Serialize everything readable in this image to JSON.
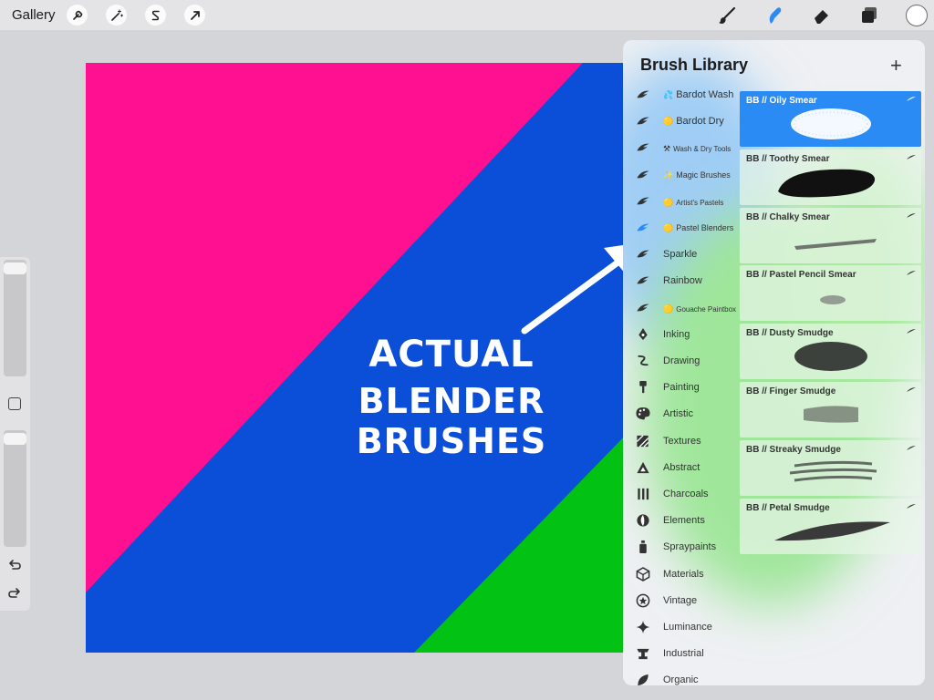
{
  "topbar": {
    "gallery_label": "Gallery",
    "left_tools": [
      "wrench-icon",
      "magic-wand-icon",
      "selection-s-icon",
      "transform-arrow-icon"
    ],
    "right_tools": [
      "paintbrush-icon",
      "smudge-icon",
      "eraser-icon",
      "layers-icon"
    ],
    "active_tool": "smudge-icon",
    "color_swatch": "#ffffff"
  },
  "canvas": {
    "colors": {
      "pink": "#ff1090",
      "blue": "#0b4ed8",
      "green": "#02c214"
    },
    "annotation": {
      "line1": "ACTUAL",
      "line2": "BLENDER BRUSHES"
    }
  },
  "panel": {
    "title": "Brush Library",
    "add_label": "+",
    "categories": [
      {
        "label": "Bardot Wash",
        "prefix": "💦"
      },
      {
        "label": "Bardot Dry",
        "prefix": "🟡"
      },
      {
        "label": "Wash & Dry Tools",
        "prefix": "⚒"
      },
      {
        "label": "Magic Brushes",
        "prefix": "✨"
      },
      {
        "label": "Artist's Pastels",
        "prefix": "🟡"
      },
      {
        "label": "Pastel Blenders",
        "prefix": "🟡"
      },
      {
        "label": "Sparkle",
        "prefix": ""
      },
      {
        "label": "Rainbow",
        "prefix": ""
      },
      {
        "label": "Gouache Paintbox",
        "prefix": "🟡"
      },
      {
        "label": "Inking",
        "prefix": ""
      },
      {
        "label": "Drawing",
        "prefix": ""
      },
      {
        "label": "Painting",
        "prefix": ""
      },
      {
        "label": "Artistic",
        "prefix": ""
      },
      {
        "label": "Textures",
        "prefix": ""
      },
      {
        "label": "Abstract",
        "prefix": ""
      },
      {
        "label": "Charcoals",
        "prefix": ""
      },
      {
        "label": "Elements",
        "prefix": ""
      },
      {
        "label": "Spraypaints",
        "prefix": ""
      },
      {
        "label": "Materials",
        "prefix": ""
      },
      {
        "label": "Vintage",
        "prefix": ""
      },
      {
        "label": "Luminance",
        "prefix": ""
      },
      {
        "label": "Industrial",
        "prefix": ""
      },
      {
        "label": "Organic",
        "prefix": ""
      }
    ],
    "selected_category": "Pastel Blenders",
    "brushes": [
      {
        "name": "BB // Oily Smear",
        "selected": true
      },
      {
        "name": "BB // Toothy Smear",
        "selected": false
      },
      {
        "name": "BB // Chalky Smear",
        "selected": false
      },
      {
        "name": "BB // Pastel Pencil Smear",
        "selected": false
      },
      {
        "name": "BB // Dusty Smudge",
        "selected": false
      },
      {
        "name": "BB // Finger Smudge",
        "selected": false
      },
      {
        "name": "BB // Streaky Smudge",
        "selected": false
      },
      {
        "name": "BB // Petal Smudge",
        "selected": false
      }
    ],
    "accent_color": "#2b8bf4"
  }
}
